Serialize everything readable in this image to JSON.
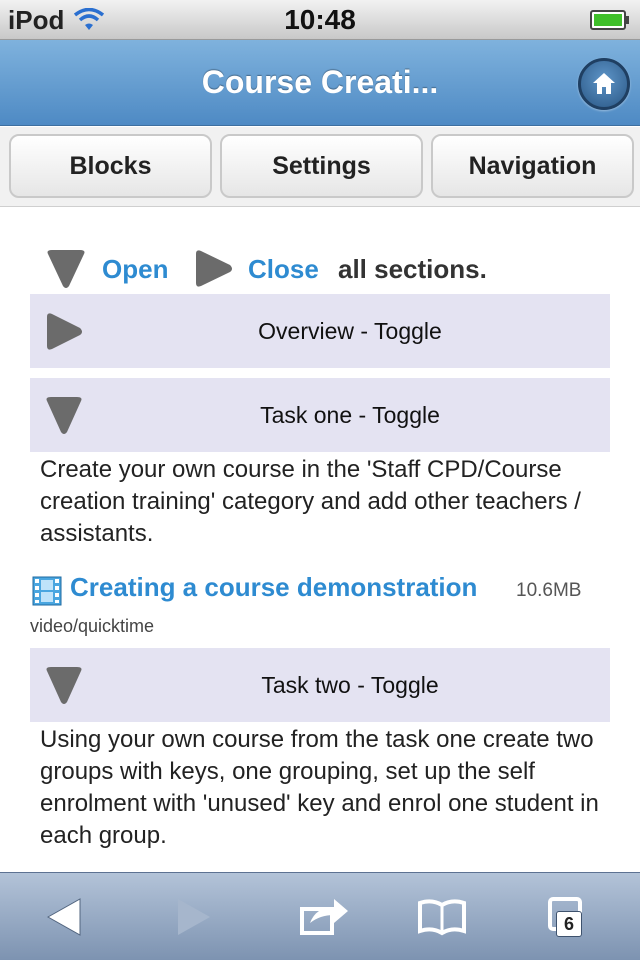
{
  "statusbar": {
    "carrier": "iPod",
    "time": "10:48"
  },
  "header": {
    "title": "Course Creati..."
  },
  "tabs": [
    {
      "label": "Blocks"
    },
    {
      "label": "Settings"
    },
    {
      "label": "Navigation"
    }
  ],
  "sections_control": {
    "open_label": "Open",
    "close_label": "Close",
    "suffix": "all sections."
  },
  "sections": [
    {
      "label": "Overview - Toggle",
      "state": "collapsed"
    },
    {
      "label": "Task one - Toggle",
      "state": "expanded",
      "text": "Create your own course in the 'Staff CPD/Course creation training' category and add other teachers / assistants."
    },
    {
      "label": "Task two - Toggle",
      "state": "expanded",
      "text": "Using your own course from the task one create two groups with keys, one grouping, set up the self enrolment with 'unused' key and enrol one student in each group."
    }
  ],
  "resource": {
    "title": "Creating a course demonstration",
    "size": "10.6MB",
    "mime": "video/quicktime",
    "icon": "film-icon"
  },
  "toolbar": {
    "tab_count": "6"
  },
  "colors": {
    "link": "#2e8bd1",
    "header": "#5b93c9",
    "toggle_bg": "#e4e3f2",
    "toolbar": "#95a8c3"
  }
}
